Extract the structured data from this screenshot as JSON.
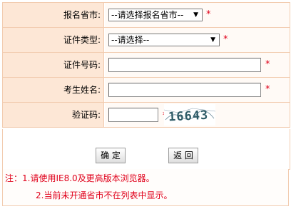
{
  "form": {
    "province": {
      "label": "报名省市:",
      "selected": "--请选择报名省市--"
    },
    "id_type": {
      "label": "证件类型:",
      "selected": "--请选择--"
    },
    "id_number": {
      "label": "证件号码:",
      "value": ""
    },
    "name": {
      "label": "考生姓名:",
      "value": ""
    },
    "captcha": {
      "label": "验证码:",
      "value": "",
      "image_text": "16643"
    },
    "required_mark": "*"
  },
  "buttons": {
    "confirm": "确 定",
    "back": "返 回"
  },
  "notes": {
    "line1": "注：1.请使用IE8.0及更高版本浏览器。",
    "line2": "2.当前未开通省市不在列表中显示。"
  },
  "colors": {
    "label_bg": "#fde7d6",
    "border": "#f2ccb0",
    "required": "#e0001a"
  }
}
